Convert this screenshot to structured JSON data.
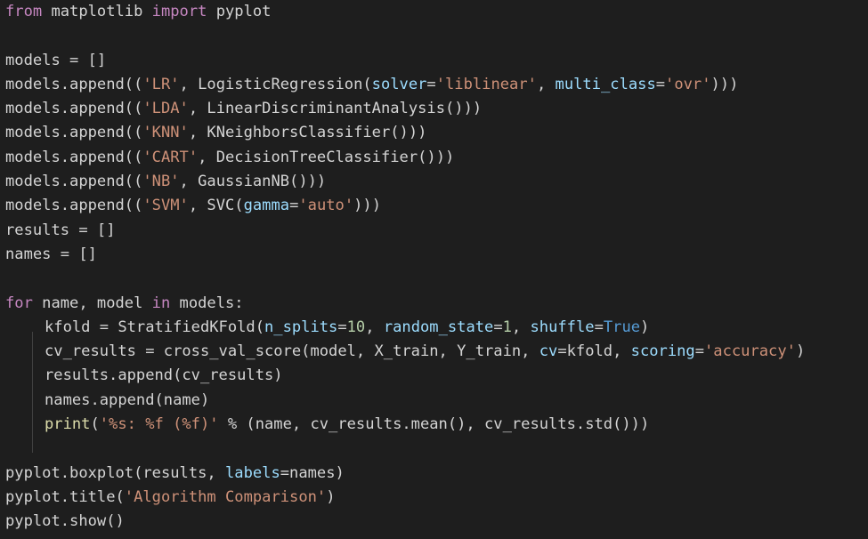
{
  "editor": {
    "language": "python",
    "lines": [
      [
        {
          "t": "kw",
          "v": "from"
        },
        {
          "t": "plain",
          "v": " matplotlib "
        },
        {
          "t": "kw",
          "v": "import"
        },
        {
          "t": "plain",
          "v": " pyplot"
        }
      ],
      [],
      [
        {
          "t": "plain",
          "v": "models = []"
        }
      ],
      [
        {
          "t": "plain",
          "v": "models.append(("
        },
        {
          "t": "str",
          "v": "'LR'"
        },
        {
          "t": "plain",
          "v": ", LogisticRegression("
        },
        {
          "t": "param",
          "v": "solver"
        },
        {
          "t": "plain",
          "v": "="
        },
        {
          "t": "str",
          "v": "'liblinear'"
        },
        {
          "t": "plain",
          "v": ", "
        },
        {
          "t": "param",
          "v": "multi_class"
        },
        {
          "t": "plain",
          "v": "="
        },
        {
          "t": "str",
          "v": "'ovr'"
        },
        {
          "t": "plain",
          "v": ")))"
        }
      ],
      [
        {
          "t": "plain",
          "v": "models.append(("
        },
        {
          "t": "str",
          "v": "'LDA'"
        },
        {
          "t": "plain",
          "v": ", LinearDiscriminantAnalysis()))"
        }
      ],
      [
        {
          "t": "plain",
          "v": "models.append(("
        },
        {
          "t": "str",
          "v": "'KNN'"
        },
        {
          "t": "plain",
          "v": ", KNeighborsClassifier()))"
        }
      ],
      [
        {
          "t": "plain",
          "v": "models.append(("
        },
        {
          "t": "str",
          "v": "'CART'"
        },
        {
          "t": "plain",
          "v": ", DecisionTreeClassifier()))"
        }
      ],
      [
        {
          "t": "plain",
          "v": "models.append(("
        },
        {
          "t": "str",
          "v": "'NB'"
        },
        {
          "t": "plain",
          "v": ", GaussianNB()))"
        }
      ],
      [
        {
          "t": "plain",
          "v": "models.append(("
        },
        {
          "t": "str",
          "v": "'SVM'"
        },
        {
          "t": "plain",
          "v": ", SVC("
        },
        {
          "t": "param",
          "v": "gamma"
        },
        {
          "t": "plain",
          "v": "="
        },
        {
          "t": "str",
          "v": "'auto'"
        },
        {
          "t": "plain",
          "v": ")))"
        }
      ],
      [
        {
          "t": "plain",
          "v": "results = []"
        }
      ],
      [
        {
          "t": "plain",
          "v": "names = []"
        }
      ],
      [],
      [
        {
          "t": "kw",
          "v": "for"
        },
        {
          "t": "plain",
          "v": " name, model "
        },
        {
          "t": "kw",
          "v": "in"
        },
        {
          "t": "plain",
          "v": " models:"
        }
      ],
      [
        {
          "t": "indent"
        },
        {
          "t": "plain",
          "v": "kfold = StratifiedKFold("
        },
        {
          "t": "param",
          "v": "n_splits"
        },
        {
          "t": "plain",
          "v": "="
        },
        {
          "t": "num",
          "v": "10"
        },
        {
          "t": "plain",
          "v": ", "
        },
        {
          "t": "param",
          "v": "random_state"
        },
        {
          "t": "plain",
          "v": "="
        },
        {
          "t": "num",
          "v": "1"
        },
        {
          "t": "plain",
          "v": ", "
        },
        {
          "t": "param",
          "v": "shuffle"
        },
        {
          "t": "plain",
          "v": "="
        },
        {
          "t": "bool",
          "v": "True"
        },
        {
          "t": "plain",
          "v": ")"
        }
      ],
      [
        {
          "t": "indent"
        },
        {
          "t": "plain",
          "v": "cv_results = cross_val_score(model, X_train, Y_train, "
        },
        {
          "t": "param",
          "v": "cv"
        },
        {
          "t": "plain",
          "v": "=kfold, "
        },
        {
          "t": "param",
          "v": "scoring"
        },
        {
          "t": "plain",
          "v": "="
        },
        {
          "t": "str",
          "v": "'accuracy'"
        },
        {
          "t": "plain",
          "v": ")"
        }
      ],
      [
        {
          "t": "indent"
        },
        {
          "t": "plain",
          "v": "results.append(cv_results)"
        }
      ],
      [
        {
          "t": "indent"
        },
        {
          "t": "plain",
          "v": "names.append(name)"
        }
      ],
      [
        {
          "t": "indent"
        },
        {
          "t": "fn",
          "v": "print"
        },
        {
          "t": "plain",
          "v": "("
        },
        {
          "t": "str",
          "v": "'%s: %f (%f)'"
        },
        {
          "t": "plain",
          "v": " % (name, cv_results.mean(), cv_results.std()))"
        }
      ],
      [],
      [
        {
          "t": "plain",
          "v": "pyplot.boxplot(results, "
        },
        {
          "t": "param",
          "v": "labels"
        },
        {
          "t": "plain",
          "v": "=names)"
        }
      ],
      [
        {
          "t": "plain",
          "v": "pyplot.title("
        },
        {
          "t": "str",
          "v": "'Algorithm Comparison'"
        },
        {
          "t": "plain",
          "v": ")"
        }
      ],
      [
        {
          "t": "plain",
          "v": "pyplot.show()"
        }
      ]
    ]
  },
  "colors": {
    "background": "#1e1e1e",
    "keyword": "#c586c0",
    "string": "#ce9178",
    "number": "#b5cea8",
    "parameter": "#9cdcfe",
    "function": "#dcdcaa",
    "boolean": "#569cd6",
    "default": "#d4d4d4"
  }
}
